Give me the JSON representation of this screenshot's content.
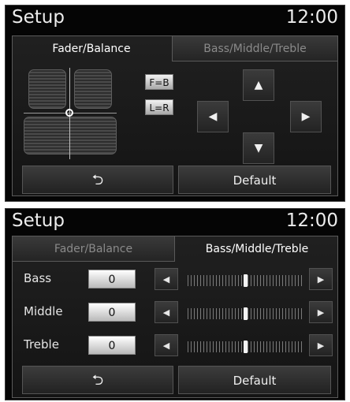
{
  "screen1": {
    "title": "Setup",
    "clock": "12:00",
    "tabs": [
      {
        "label": "Fader/Balance",
        "active": true
      },
      {
        "label": "Bass/Middle/Treble",
        "active": false
      }
    ],
    "fb_button": "F=B",
    "lr_button": "L=R",
    "arrows": {
      "up": "▲",
      "left": "◀",
      "right": "▶",
      "down": "▼"
    },
    "back_glyph": "⮌",
    "default_label": "Default"
  },
  "screen2": {
    "title": "Setup",
    "clock": "12:00",
    "tabs": [
      {
        "label": "Fader/Balance",
        "active": false
      },
      {
        "label": "Bass/Middle/Treble",
        "active": true
      }
    ],
    "rows": [
      {
        "label": "Bass",
        "value": "0",
        "level": 0.5
      },
      {
        "label": "Middle",
        "value": "0",
        "level": 0.5
      },
      {
        "label": "Treble",
        "value": "0",
        "level": 0.5
      }
    ],
    "step_glyphs": {
      "dec": "◀",
      "inc": "▶"
    },
    "back_glyph": "⮌",
    "default_label": "Default"
  },
  "colors": {
    "background": "#050505",
    "accent": "#ffffff",
    "button_face": "#2e2e2e"
  }
}
